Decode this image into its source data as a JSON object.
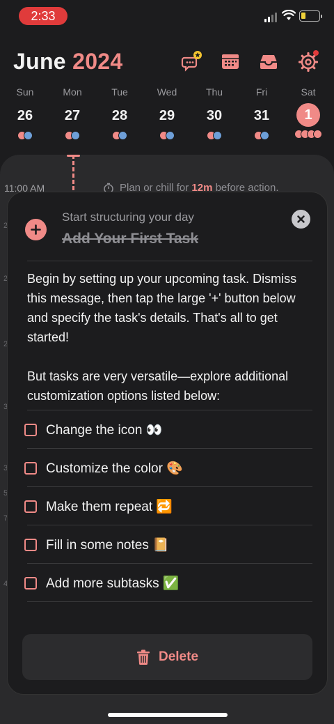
{
  "status_bar": {
    "time": "2:33"
  },
  "header": {
    "month": "June",
    "year": "2024",
    "icons": [
      "feedback-star-icon",
      "calendar-icon",
      "inbox-icon",
      "settings-gear-icon"
    ],
    "accent_color": "#f08a87"
  },
  "week": {
    "days": [
      {
        "name": "Sun",
        "num": "26"
      },
      {
        "name": "Mon",
        "num": "27"
      },
      {
        "name": "Tue",
        "num": "28"
      },
      {
        "name": "Wed",
        "num": "29"
      },
      {
        "name": "Thu",
        "num": "30"
      },
      {
        "name": "Fri",
        "num": "31"
      },
      {
        "name": "Sat",
        "num": "1"
      }
    ],
    "selected_day": "Sat"
  },
  "timeline": {
    "time_label": "11:00 AM",
    "plan_prefix": "Plan or chill for",
    "plan_duration": "12m",
    "plan_suffix": "before action."
  },
  "sheet": {
    "subtitle": "Start structuring your day",
    "title": "Add Your First Task",
    "paragraph1": "Begin by setting up your upcoming task. Dismiss this message, then tap the large '+' button below and specify the task's details. That's all to get started!",
    "paragraph2": "But tasks are very versatile—explore additional customization options listed below:",
    "checklist": [
      "Change the icon 👀",
      "Customize the color 🎨",
      "Make them repeat 🔁",
      "Fill in some notes 📔",
      "Add more subtasks ✅"
    ],
    "delete_label": "Delete"
  }
}
